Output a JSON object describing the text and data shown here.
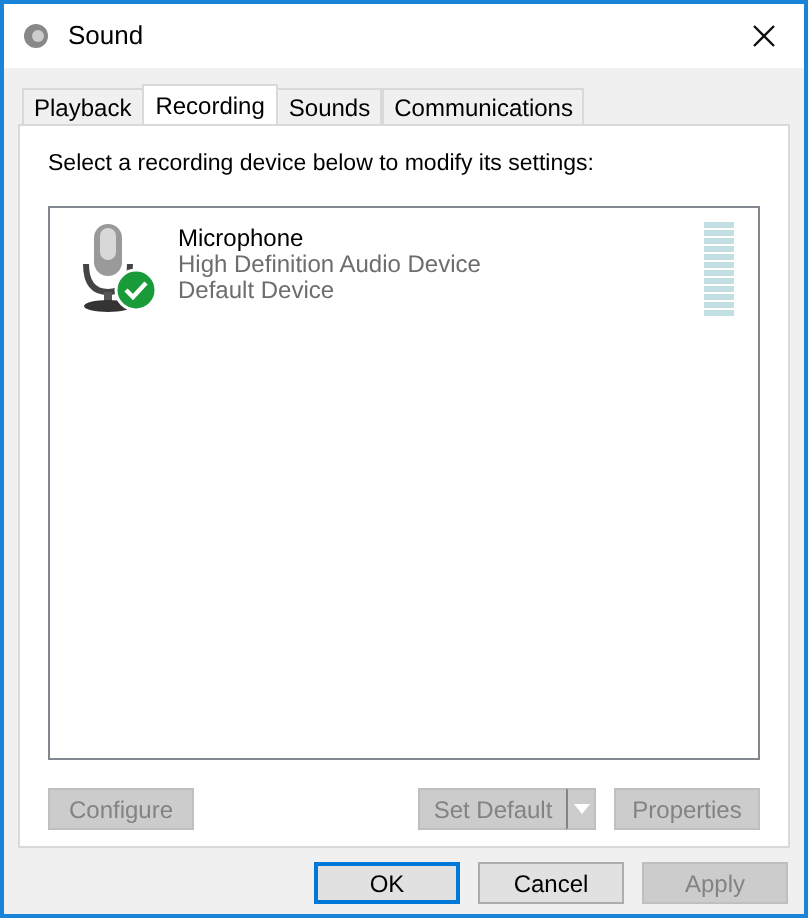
{
  "window": {
    "title": "Sound"
  },
  "tabs": [
    {
      "label": "Playback",
      "selected": false
    },
    {
      "label": "Recording",
      "selected": true
    },
    {
      "label": "Sounds",
      "selected": false
    },
    {
      "label": "Communications",
      "selected": false
    }
  ],
  "instruction": "Select a recording device below to modify its settings:",
  "devices": [
    {
      "name": "Microphone",
      "description": "High Definition Audio Device",
      "status": "Default Device",
      "is_default": true,
      "selected": false,
      "level": 0
    }
  ],
  "device_buttons": [
    {
      "label": "Configure",
      "kind": "plain",
      "disabled": true
    },
    {
      "label": "Set Default",
      "kind": "split",
      "disabled": true
    },
    {
      "label": "Properties",
      "kind": "plain",
      "disabled": true
    }
  ],
  "dialog_buttons": [
    {
      "label": "OK",
      "default": true,
      "disabled": false
    },
    {
      "label": "Cancel",
      "default": false,
      "disabled": false
    },
    {
      "label": "Apply",
      "default": false,
      "disabled": true
    }
  ]
}
